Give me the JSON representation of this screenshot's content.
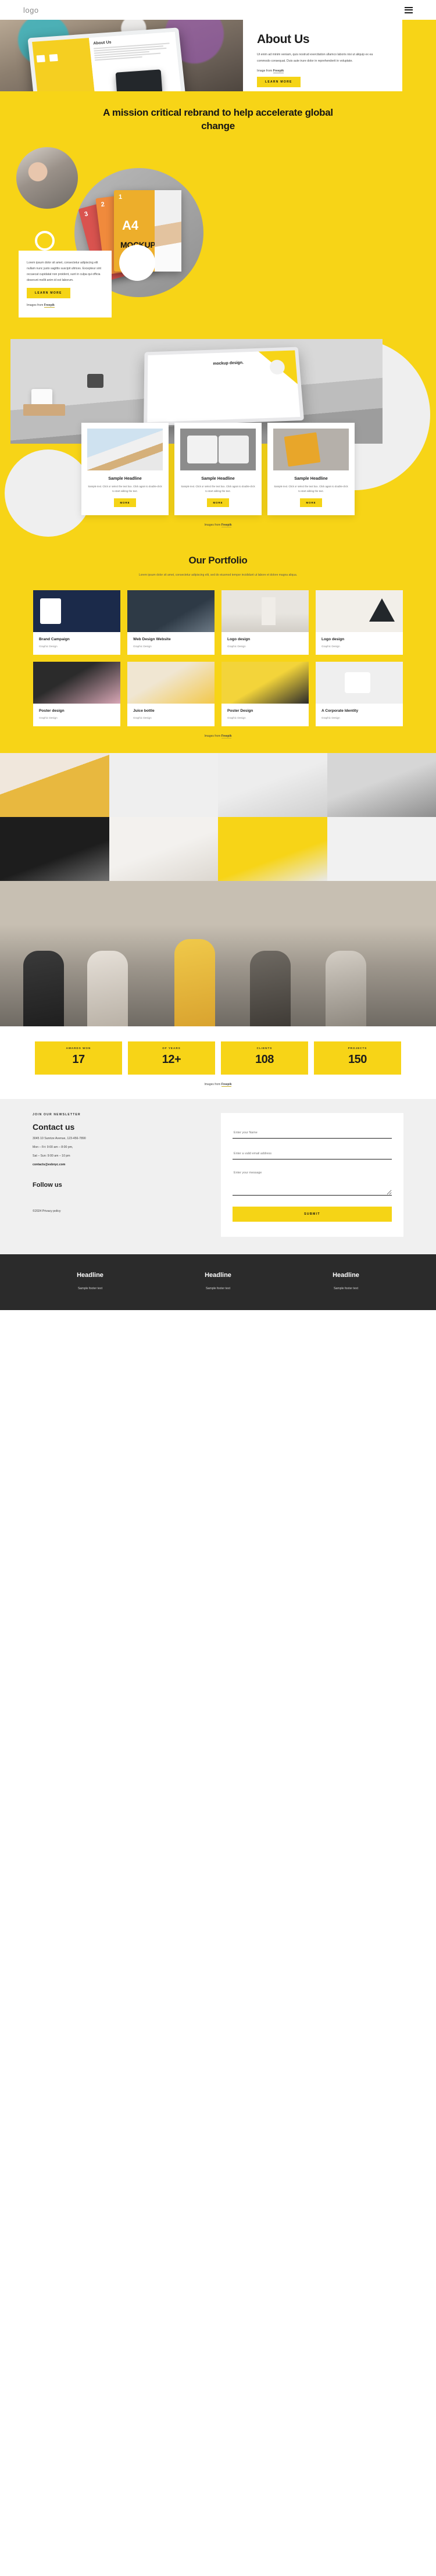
{
  "nav": {
    "logo": "logo",
    "menu_icon": "hamburger-menu-icon"
  },
  "hero": {
    "title": "About Us",
    "paragraph": "Ut enim ad minim veniam, quis nostrud exercitation ullamco laboris nisi ut aliquip ex ea commodo consequat. Duis aute irure dolor in reprehenderit in voluptate.",
    "credit_prefix": "Image from ",
    "credit_link": "Freepik",
    "button": "LEARN MORE",
    "laptop_title": "About Us"
  },
  "mission": {
    "heading": "A mission critical rebrand to help accelerate global change",
    "card_paragraph": "Lorem ipsum dolor sit amet, consectetur adipiscing elit nullam nunc justo sagittis suscipit ultrices. Excepteur sint occaecat cupidatat non proident, sunt in culpa qui officia deserunt mollit anim id est laborum.",
    "card_button": "LEARN MORE",
    "credit_prefix": "Images from ",
    "credit_link": "Freepik",
    "mockup_labels": {
      "n1": "1",
      "n2": "2",
      "n3": "3",
      "a4": "A4",
      "mockup": "MOCKUP"
    }
  },
  "desk": {
    "laptop_label": "mockup design.",
    "credit_prefix": "Images from ",
    "credit_link": "Freepik",
    "cards": [
      {
        "title": "Sample Headline",
        "text": "Sample text. Click or select the text box. Click again to double-click to start editing the text.",
        "button": "MORE",
        "thumb": "building-photo"
      },
      {
        "title": "Sample Headline",
        "text": "Sample text. Click or select the text box. Click again to double-click to start editing the text.",
        "button": "MORE",
        "thumb": "sweater-mockup-photo"
      },
      {
        "title": "Sample Headline",
        "text": "Sample text. Click or select the text box. Click again to double-click to start editing the text.",
        "button": "MORE",
        "thumb": "brochure-mockup-photo"
      }
    ]
  },
  "portfolio": {
    "heading": "Our Portfolio",
    "subtitle": "Lorem ipsum dolor sit amet, consectetur adipiscing elit, sed do eiusmod tempor incididunt ut labore et dolore magna aliqua.",
    "credit_prefix": "Images from ",
    "credit_link": "Freepik",
    "items": [
      {
        "title": "Brand Campaign",
        "tag": "Graphic Design",
        "thumb": "brand-campaign-thumb"
      },
      {
        "title": "Web Design Website",
        "tag": "Graphic Design",
        "thumb": "web-design-thumb"
      },
      {
        "title": "Logo design",
        "tag": "Graphic Design",
        "thumb": "logo-design-thumb"
      },
      {
        "title": "Logo design",
        "tag": "Graphic Design",
        "thumb": "logo-design-alt-thumb"
      },
      {
        "title": "Poster design",
        "tag": "Graphic Design",
        "thumb": "poster-design-thumb"
      },
      {
        "title": "Juice bottle",
        "tag": "Graphic Design",
        "thumb": "juice-bottle-thumb"
      },
      {
        "title": "Poster Design",
        "tag": "Graphic Design",
        "thumb": "poster-design-alt-thumb"
      },
      {
        "title": "A Corporate Identity",
        "tag": "Graphic Design",
        "thumb": "corporate-identity-thumb"
      }
    ]
  },
  "gallery": {
    "tiles": [
      "portrait-woman-yellow-sweater",
      "architecture-white-grid",
      "dark-ceiling-structure",
      "portrait-man-grayscale",
      "car-wheel-closeup",
      "portrait-woman-turtleneck",
      "yellow-abstract-texture",
      "white-frames-wall"
    ]
  },
  "team": {
    "alt": "team-meeting-photo"
  },
  "stats": {
    "items": [
      {
        "label": "AWARDS WON",
        "value": "17"
      },
      {
        "label": "OF YEARS",
        "value": "12+"
      },
      {
        "label": "CLIENTS",
        "value": "108"
      },
      {
        "label": "PROJECTS",
        "value": "150"
      }
    ],
    "credit_prefix": "Images from ",
    "credit_link": "Freepik"
  },
  "contact": {
    "kicker": "JOIN OUR NEWSLETTER",
    "title": "Contact us",
    "address": "3045 10 Sunrize Avenue, 123-456-7890",
    "hours_weekday": "Mon – Fri: 9:00 am – 8:00 pm,",
    "hours_weekend": "Sat – Sun: 9:00 am – 10 pm",
    "email": "contacts@esbnyc.com",
    "follow_title": "Follow us",
    "copyright": "©2024 Privacy policy",
    "form": {
      "name_placeholder": "Enter your Name",
      "email_placeholder": "Enter a valid email address",
      "message_placeholder": "Enter your message",
      "submit": "SUBMIT"
    }
  },
  "footer": {
    "columns": [
      {
        "title": "Headline",
        "text": "Sample footer text"
      },
      {
        "title": "Headline",
        "text": "Sample footer text"
      },
      {
        "title": "Headline",
        "text": "Sample footer text"
      }
    ]
  },
  "colors": {
    "accent": "#f7d417",
    "dark": "#2b2b2b",
    "light": "#f0f0f0"
  }
}
